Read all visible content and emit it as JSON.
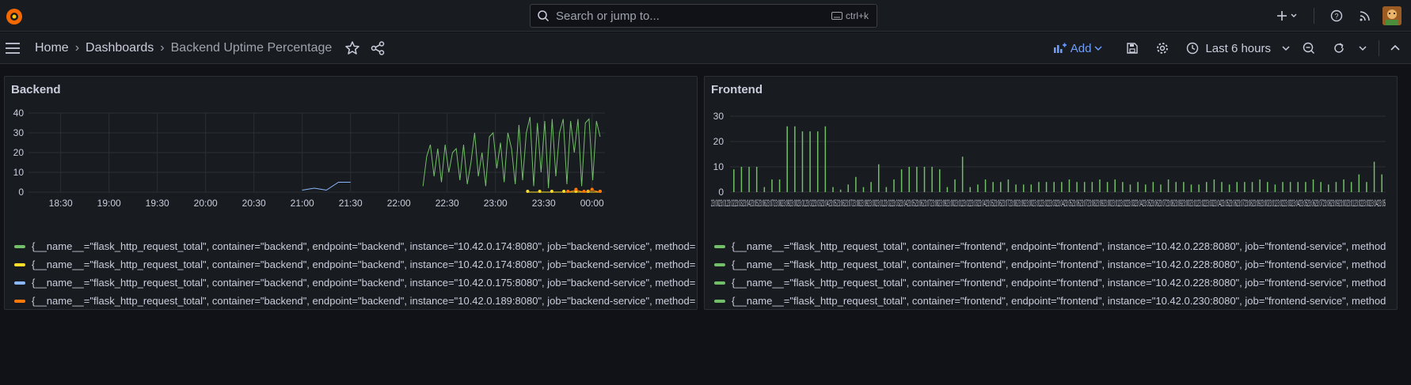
{
  "topbar": {
    "search_placeholder": "Search or jump to...",
    "search_shortcut": "ctrl+k"
  },
  "breadcrumb": {
    "home": "Home",
    "dashboards": "Dashboards",
    "current": "Backend Uptime Percentage"
  },
  "toolbar": {
    "add_label": "Add",
    "time_range": "Last 6 hours"
  },
  "colors": {
    "green": "#73bf69",
    "yellow": "#fade2a",
    "blue": "#8ab8ff",
    "orange": "#ff780a",
    "accent": "#6e9fff"
  },
  "panels": [
    {
      "title": "Backend",
      "legend": [
        {
          "color": "#73bf69",
          "text": "{__name__=\"flask_http_request_total\", container=\"backend\", endpoint=\"backend\", instance=\"10.42.0.174:8080\", job=\"backend-service\", method="
        },
        {
          "color": "#fade2a",
          "text": "{__name__=\"flask_http_request_total\", container=\"backend\", endpoint=\"backend\", instance=\"10.42.0.174:8080\", job=\"backend-service\", method="
        },
        {
          "color": "#8ab8ff",
          "text": "{__name__=\"flask_http_request_total\", container=\"backend\", endpoint=\"backend\", instance=\"10.42.0.175:8080\", job=\"backend-service\", method="
        },
        {
          "color": "#ff780a",
          "text": "{__name__=\"flask_http_request_total\", container=\"backend\", endpoint=\"backend\", instance=\"10.42.0.189:8080\", job=\"backend-service\", method="
        }
      ]
    },
    {
      "title": "Frontend",
      "legend": [
        {
          "color": "#73bf69",
          "text": "{__name__=\"flask_http_request_total\", container=\"frontend\", endpoint=\"frontend\", instance=\"10.42.0.228:8080\", job=\"frontend-service\", method"
        },
        {
          "color": "#73bf69",
          "text": "{__name__=\"flask_http_request_total\", container=\"frontend\", endpoint=\"frontend\", instance=\"10.42.0.228:8080\", job=\"frontend-service\", method"
        },
        {
          "color": "#73bf69",
          "text": "{__name__=\"flask_http_request_total\", container=\"frontend\", endpoint=\"frontend\", instance=\"10.42.0.228:8080\", job=\"frontend-service\", method"
        },
        {
          "color": "#73bf69",
          "text": "{__name__=\"flask_http_request_total\", container=\"frontend\", endpoint=\"frontend\", instance=\"10.42.0.230:8080\", job=\"frontend-service\", method"
        }
      ]
    }
  ],
  "chart_data": [
    {
      "type": "line",
      "yticks": [
        "0",
        "10",
        "20",
        "30",
        "40"
      ],
      "ylim": [
        0,
        40
      ],
      "xticks": [
        "18:30",
        "19:00",
        "19:30",
        "20:00",
        "20:30",
        "21:00",
        "21:30",
        "22:00",
        "22:30",
        "23:00",
        "23:30",
        "00:00"
      ],
      "series": [
        {
          "color": "#73bf69",
          "start": "22:15",
          "end": "00:05",
          "values": [
            3,
            18,
            24,
            8,
            22,
            5,
            24,
            10,
            20,
            22,
            6,
            24,
            4,
            15,
            30,
            8,
            20,
            3,
            28,
            30,
            12,
            25,
            5,
            30,
            22,
            4,
            34,
            6,
            30,
            38,
            3,
            35,
            10,
            36,
            2,
            37,
            8,
            30,
            37,
            4,
            36,
            20,
            37,
            3,
            35,
            37,
            6,
            36,
            28
          ]
        },
        {
          "color": "#fade2a",
          "start": "23:20",
          "end": "00:05",
          "values": [
            0,
            0,
            0,
            0,
            0,
            0,
            0
          ]
        },
        {
          "color": "#8ab8ff",
          "start": "21:00",
          "end": "21:30",
          "values": [
            1,
            2,
            1,
            5,
            5
          ]
        },
        {
          "color": "#ff780a",
          "start": "23:45",
          "end": "00:05",
          "values": [
            0,
            1,
            0,
            1,
            0
          ]
        }
      ]
    },
    {
      "type": "bar",
      "yticks": [
        "0",
        "10",
        "20",
        "30"
      ],
      "ylim": [
        0,
        30
      ],
      "values": [
        9,
        10,
        10,
        10,
        2,
        5,
        5,
        26,
        26,
        24,
        24,
        24,
        26,
        2,
        1,
        3,
        6,
        2,
        4,
        11,
        2,
        5,
        9,
        10,
        10,
        10,
        10,
        9,
        2,
        5,
        14,
        2,
        3,
        5,
        4,
        4,
        5,
        3,
        3,
        3,
        4,
        4,
        4,
        4,
        5,
        4,
        4,
        4,
        5,
        4,
        5,
        4,
        3,
        4,
        3,
        4,
        3,
        5,
        4,
        4,
        3,
        3,
        4,
        5,
        4,
        3,
        4,
        4,
        4,
        5,
        4,
        3,
        4,
        4,
        4,
        4,
        5,
        4,
        3,
        4,
        5,
        4,
        7,
        4,
        12,
        7
      ]
    }
  ]
}
